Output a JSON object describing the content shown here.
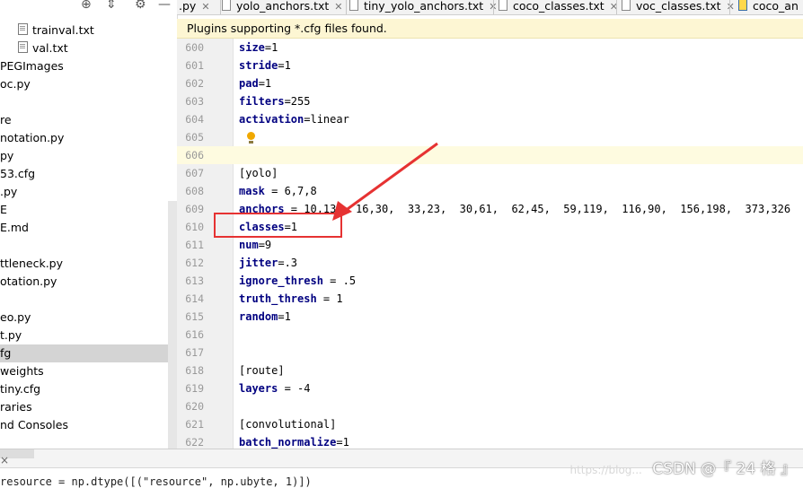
{
  "sidebar": {
    "items": [
      {
        "label": "trainval.txt",
        "icon": true,
        "indent": 20
      },
      {
        "label": "val.txt",
        "icon": true,
        "indent": 20
      },
      {
        "label": "PEGImages"
      },
      {
        "label": "oc.py"
      },
      {
        "label": ""
      },
      {
        "label": "re"
      },
      {
        "label": "notation.py"
      },
      {
        "label": "py"
      },
      {
        "label": "53.cfg"
      },
      {
        "label": ".py"
      },
      {
        "label": "E"
      },
      {
        "label": "E.md"
      },
      {
        "label": ""
      },
      {
        "label": "ttleneck.py"
      },
      {
        "label": "otation.py"
      },
      {
        "label": ""
      },
      {
        "label": "eo.py"
      },
      {
        "label": "t.py"
      },
      {
        "label": "fg",
        "selected": true
      },
      {
        "label": "weights"
      },
      {
        "label": "tiny.cfg"
      },
      {
        "label": "raries"
      },
      {
        "label": "nd Consoles"
      }
    ]
  },
  "tabs": [
    {
      "label": ".py"
    },
    {
      "label": "yolo_anchors.txt"
    },
    {
      "label": "tiny_yolo_anchors.txt"
    },
    {
      "label": "coco_classes.txt"
    },
    {
      "label": "voc_classes.txt"
    },
    {
      "label": "coco_an"
    }
  ],
  "banner": "Plugins supporting *.cfg files found.",
  "editor": {
    "lines": [
      {
        "num": "600",
        "key": "size",
        "rest": "=1"
      },
      {
        "num": "601",
        "key": "stride",
        "rest": "=1"
      },
      {
        "num": "602",
        "key": "pad",
        "rest": "=1"
      },
      {
        "num": "603",
        "key": "filters",
        "rest": "=255"
      },
      {
        "num": "604",
        "key": "activation",
        "rest": "=linear"
      },
      {
        "num": "605",
        "key": "",
        "rest": ""
      },
      {
        "num": "606",
        "key": "",
        "rest": ""
      },
      {
        "num": "607",
        "key": "",
        "rest": "[yolo]"
      },
      {
        "num": "608",
        "key": "mask",
        "rest": " = 6,7,8"
      },
      {
        "num": "609",
        "key": "anchors",
        "rest": " = 10,13,  16,30,  33,23,  30,61,  62,45,  59,119,  116,90,  156,198,  373,326"
      },
      {
        "num": "610",
        "key": "classes",
        "rest": "=1"
      },
      {
        "num": "611",
        "key": "num",
        "rest": "=9"
      },
      {
        "num": "612",
        "key": "jitter",
        "rest": "=.3"
      },
      {
        "num": "613",
        "key": "ignore_thresh",
        "rest": " = .5"
      },
      {
        "num": "614",
        "key": "truth_thresh",
        "rest": " = 1"
      },
      {
        "num": "615",
        "key": "random",
        "rest": "=1"
      },
      {
        "num": "616",
        "key": "",
        "rest": ""
      },
      {
        "num": "617",
        "key": "",
        "rest": ""
      },
      {
        "num": "618",
        "key": "",
        "rest": "[route]"
      },
      {
        "num": "619",
        "key": "layers",
        "rest": " = -4"
      },
      {
        "num": "620",
        "key": "",
        "rest": ""
      },
      {
        "num": "621",
        "key": "",
        "rest": "[convolutional]"
      },
      {
        "num": "622",
        "key": "batch_normalize",
        "rest": "=1"
      }
    ]
  },
  "bottom": {
    "close": "×",
    "code": "resource = np.dtype([(\"resource\", np.ubyte, 1)])"
  },
  "watermark": {
    "url": "https://blog...",
    "brand": "CSDN @『 24 格 』"
  },
  "colors": {
    "banner_bg": "#fdf6d3",
    "annotation": "#e63232",
    "keyword": "#000080"
  }
}
